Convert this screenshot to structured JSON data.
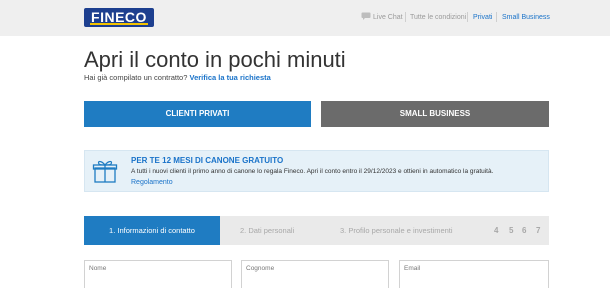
{
  "brand": {
    "logo_text": "FINECO",
    "primary_color": "#1f7cc2",
    "logo_color": "#1d3f8f",
    "accent_yellow": "#f3c300"
  },
  "topnav": {
    "live_chat": "Live Chat",
    "terms": "Tutte le condizioni",
    "private": "Privati",
    "small_business": "Small Business",
    "chat_icon": "chat-bubble-icon"
  },
  "page": {
    "title": "Apri il conto in pochi minuti",
    "subtitle_prefix": "Hai già compilato un contratto?",
    "subtitle_link": "Verifica la tua richiesta"
  },
  "account_type": {
    "private_label": "CLIENTI PRIVATI",
    "business_label": "SMALL BUSINESS",
    "selected": "CLIENTI PRIVATI"
  },
  "promo": {
    "icon": "gift-icon",
    "title": "PER TE 12 MESI DI CANONE GRATUITO",
    "text": "A tutti i nuovi clienti il primo anno di canone lo regala Fineco. Apri il conto entro il 29/12/2023 e ottieni in automatico la gratuità.",
    "link": "Regolamento"
  },
  "steps": {
    "step1": "1. Informazioni di contatto",
    "step2": "2. Dati personali",
    "step3": "3. Profilo personale e investimenti",
    "step4": "4",
    "step5": "5",
    "step6": "6",
    "step7": "7",
    "active": 1
  },
  "form": {
    "nome_label": "Nome",
    "cognome_label": "Cognome",
    "email_label": "Email"
  }
}
